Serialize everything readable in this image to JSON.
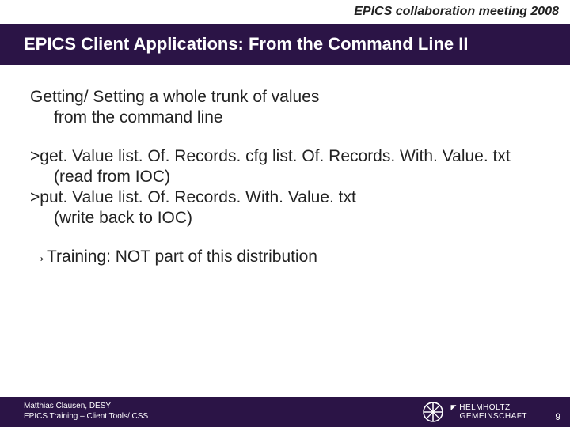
{
  "header": {
    "event": "EPICS collaboration meeting 2008"
  },
  "title": "EPICS Client Applications: From the Command Line II",
  "body": {
    "intro_l1": "Getting/ Setting a whole trunk of values",
    "intro_l2": "from the command line",
    "cmd1": ">get. Value list. Of. Records. cfg list. Of. Records. With. Value. txt",
    "cmd1_note": "(read from IOC)",
    "cmd2": ">put. Value list. Of. Records. With. Value. txt",
    "cmd2_note": "(write back to IOC)",
    "training_arrow": "→",
    "training": "Training: NOT part of this distribution"
  },
  "footer": {
    "author": "Matthias Clausen, DESY",
    "course": "EPICS Training – Client Tools/ CSS",
    "helm_l1": "HELMHOLTZ",
    "helm_l2": "GEMEINSCHAFT",
    "page": "9"
  }
}
